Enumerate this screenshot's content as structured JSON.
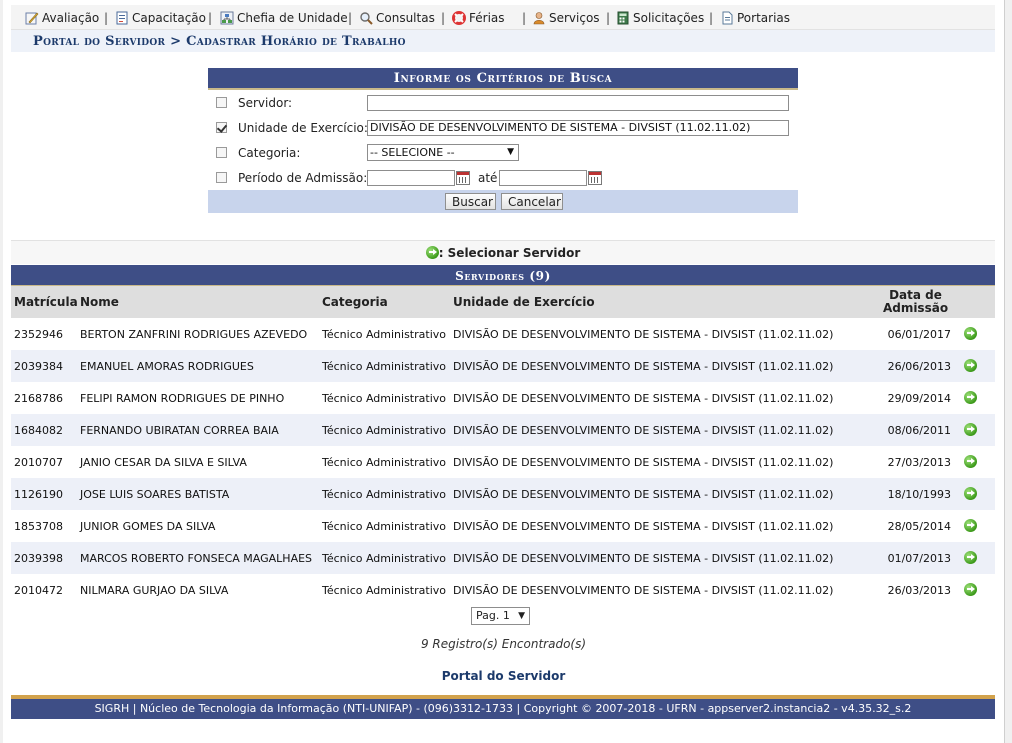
{
  "menu": {
    "items": [
      {
        "label": "Avaliação",
        "icon": "edit-icon"
      },
      {
        "label": "Capacitação",
        "icon": "form-icon"
      },
      {
        "label": "Chefia de Unidade",
        "icon": "org-chart-icon"
      },
      {
        "label": "Consultas",
        "icon": "magnifier-icon"
      },
      {
        "label": "Férias",
        "icon": "lifebuoy-icon"
      },
      {
        "label": "Serviços",
        "icon": "user-icon"
      },
      {
        "label": "Solicitações",
        "icon": "calculator-icon"
      },
      {
        "label": "Portarias",
        "icon": "document-icon"
      }
    ],
    "separator": "|"
  },
  "breadcrumb": "Portal do Servidor > Cadastrar Horário de Trabalho",
  "search": {
    "title": "Informe os Critérios de Busca",
    "fields": {
      "servidor": {
        "label": "Servidor:",
        "checked": false,
        "value": ""
      },
      "unidade": {
        "label": "Unidade de Exercício:",
        "checked": true,
        "value": "DIVISÃO DE DESENVOLVIMENTO DE SISTEMA - DIVSIST (11.02.11.02)"
      },
      "categoria": {
        "label": "Categoria:",
        "checked": false,
        "value": "-- SELECIONE --"
      },
      "periodo": {
        "label": "Período de Admissão:",
        "checked": false,
        "start": "",
        "end": "",
        "ate": "até"
      }
    },
    "buttons": {
      "buscar": "Buscar",
      "cancelar": "Cancelar"
    }
  },
  "legend": {
    "text": ": Selecionar Servidor"
  },
  "results": {
    "title": "Servidores (9)",
    "columns": {
      "matricula": "Matrícula",
      "nome": "Nome",
      "categoria": "Categoria",
      "unidade": "Unidade de Exercício",
      "data": "Data de Admissão"
    },
    "rows": [
      {
        "matricula": "2352946",
        "nome": "BERTON ZANFRINI RODRIGUES AZEVEDO",
        "categoria": "Técnico Administrativo",
        "unidade": "DIVISÃO DE DESENVOLVIMENTO DE SISTEMA - DIVSIST (11.02.11.02)",
        "data": "06/01/2017"
      },
      {
        "matricula": "2039384",
        "nome": "EMANUEL AMORAS RODRIGUES",
        "categoria": "Técnico Administrativo",
        "unidade": "DIVISÃO DE DESENVOLVIMENTO DE SISTEMA - DIVSIST (11.02.11.02)",
        "data": "26/06/2013"
      },
      {
        "matricula": "2168786",
        "nome": "FELIPI RAMON RODRIGUES DE PINHO",
        "categoria": "Técnico Administrativo",
        "unidade": "DIVISÃO DE DESENVOLVIMENTO DE SISTEMA - DIVSIST (11.02.11.02)",
        "data": "29/09/2014"
      },
      {
        "matricula": "1684082",
        "nome": "FERNANDO UBIRATAN CORREA BAIA",
        "categoria": "Técnico Administrativo",
        "unidade": "DIVISÃO DE DESENVOLVIMENTO DE SISTEMA - DIVSIST (11.02.11.02)",
        "data": "08/06/2011"
      },
      {
        "matricula": "2010707",
        "nome": "JANIO CESAR DA SILVA E SILVA",
        "categoria": "Técnico Administrativo",
        "unidade": "DIVISÃO DE DESENVOLVIMENTO DE SISTEMA - DIVSIST (11.02.11.02)",
        "data": "27/03/2013"
      },
      {
        "matricula": "1126190",
        "nome": "JOSE LUIS SOARES BATISTA",
        "categoria": "Técnico Administrativo",
        "unidade": "DIVISÃO DE DESENVOLVIMENTO DE SISTEMA - DIVSIST (11.02.11.02)",
        "data": "18/10/1993"
      },
      {
        "matricula": "1853708",
        "nome": "JUNIOR GOMES DA SILVA",
        "categoria": "Técnico Administrativo",
        "unidade": "DIVISÃO DE DESENVOLVIMENTO DE SISTEMA - DIVSIST (11.02.11.02)",
        "data": "28/05/2014"
      },
      {
        "matricula": "2039398",
        "nome": "MARCOS ROBERTO FONSECA MAGALHAES",
        "categoria": "Técnico Administrativo",
        "unidade": "DIVISÃO DE DESENVOLVIMENTO DE SISTEMA - DIVSIST (11.02.11.02)",
        "data": "01/07/2013"
      },
      {
        "matricula": "2010472",
        "nome": "NILMARA GURJAO DA SILVA",
        "categoria": "Técnico Administrativo",
        "unidade": "DIVISÃO DE DESENVOLVIMENTO DE SISTEMA - DIVSIST (11.02.11.02)",
        "data": "26/03/2013"
      }
    ]
  },
  "pager": {
    "value": "Pag. 1"
  },
  "count": "9 Registro(s) Encontrado(s)",
  "portal_link": "Portal do Servidor",
  "footer": "SIGRH | Núcleo de Tecnologia da Informação (NTI-UNIFAP) - (096)3312-1733 | Copyright © 2007-2018 - UFRN - appserver2.instancia2 - v4.35.32_s.2",
  "colors": {
    "header_blue": "#3e4e86",
    "link_blue": "#1c3a6b",
    "stripe": "#edf0f8",
    "footer_accent": "#d2a24c"
  }
}
